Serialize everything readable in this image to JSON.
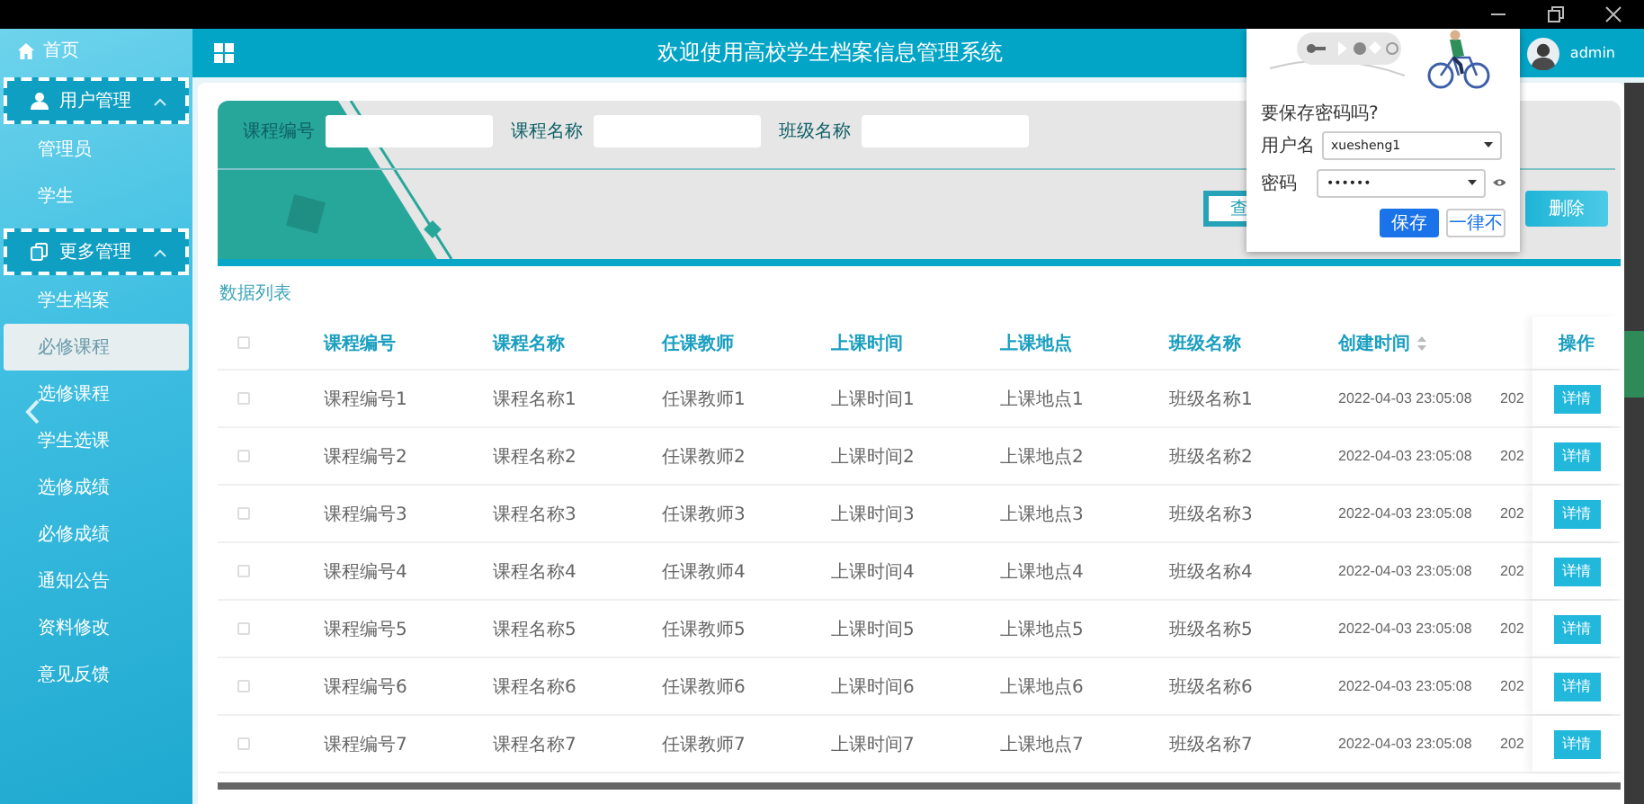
{
  "header": {
    "title": "欢迎使用高校学生档案信息管理系统",
    "user": "admin"
  },
  "sidebar": {
    "items": [
      {
        "kind": "link",
        "label": "首页",
        "selected": false
      },
      {
        "kind": "group",
        "label": "用户管理",
        "expanded": true,
        "children": [
          {
            "label": "管理员",
            "selected": false
          },
          {
            "label": "学生",
            "selected": false
          }
        ]
      },
      {
        "kind": "group",
        "label": "更多管理",
        "expanded": true,
        "children": [
          {
            "label": "学生档案",
            "selected": false
          },
          {
            "label": "必修课程",
            "selected": true
          },
          {
            "label": "选修课程",
            "selected": false
          },
          {
            "label": "学生选课",
            "selected": false
          },
          {
            "label": "选修成绩",
            "selected": false
          },
          {
            "label": "必修成绩",
            "selected": false
          },
          {
            "label": "通知公告",
            "selected": false
          },
          {
            "label": "资料修改",
            "selected": false
          },
          {
            "label": "意见反馈",
            "selected": false
          }
        ]
      }
    ]
  },
  "search": {
    "fields": [
      {
        "label": "课程编号"
      },
      {
        "label": "课程名称"
      },
      {
        "label": "班级名称"
      }
    ],
    "buttons": [
      {
        "kind": "outline",
        "label": "查"
      },
      {
        "kind": "solid",
        "label": "删除"
      }
    ]
  },
  "list_title": "数据列表",
  "table": {
    "all_checked": false,
    "columns": [
      {
        "label": "课程编号",
        "sortable": false
      },
      {
        "label": "课程名称",
        "sortable": false
      },
      {
        "label": "任课教师",
        "sortable": false
      },
      {
        "label": "上课时间",
        "sortable": false
      },
      {
        "label": "上课地点",
        "sortable": false
      },
      {
        "label": "班级名称",
        "sortable": false
      },
      {
        "label": "创建时间",
        "sortable": true
      }
    ],
    "action_column": "操作",
    "rows": [
      {
        "checked": false,
        "cells": [
          "课程编号1",
          "课程名称1",
          "任课教师1",
          "上课时间1",
          "上课地点1",
          "班级名称1",
          "2022-04-03 23:05:08"
        ],
        "column_8": "202",
        "action": "详情"
      },
      {
        "checked": false,
        "cells": [
          "课程编号2",
          "课程名称2",
          "任课教师2",
          "上课时间2",
          "上课地点2",
          "班级名称2",
          "2022-04-03 23:05:08"
        ],
        "column_8": "202",
        "action": "详情"
      },
      {
        "checked": false,
        "cells": [
          "课程编号3",
          "课程名称3",
          "任课教师3",
          "上课时间3",
          "上课地点3",
          "班级名称3",
          "2022-04-03 23:05:08"
        ],
        "column_8": "202",
        "action": "详情"
      },
      {
        "checked": false,
        "cells": [
          "课程编号4",
          "课程名称4",
          "任课教师4",
          "上课时间4",
          "上课地点4",
          "班级名称4",
          "2022-04-03 23:05:08"
        ],
        "column_8": "202",
        "action": "详情"
      },
      {
        "checked": false,
        "cells": [
          "课程编号5",
          "课程名称5",
          "任课教师5",
          "上课时间5",
          "上课地点5",
          "班级名称5",
          "2022-04-03 23:05:08"
        ],
        "column_8": "202",
        "action": "详情"
      },
      {
        "checked": false,
        "cells": [
          "课程编号6",
          "课程名称6",
          "任课教师6",
          "上课时间6",
          "上课地点6",
          "班级名称6",
          "2022-04-03 23:05:08"
        ],
        "column_8": "202",
        "action": "详情"
      },
      {
        "checked": false,
        "cells": [
          "课程编号7",
          "课程名称7",
          "任课教师7",
          "上课时间7",
          "上课地点7",
          "班级名称7",
          "2022-04-03 23:05:08"
        ],
        "column_8": "202",
        "action": "详情"
      }
    ]
  },
  "password_popup": {
    "title": "要保存密码吗?",
    "fields": [
      {
        "kind": "text",
        "label": "用户名",
        "value": "xuesheng1"
      },
      {
        "kind": "password",
        "label": "密码",
        "value": "••••••"
      }
    ],
    "buttons": [
      {
        "kind": "primary",
        "label": "保存"
      },
      {
        "kind": "secondary",
        "label": "一律不"
      }
    ]
  }
}
